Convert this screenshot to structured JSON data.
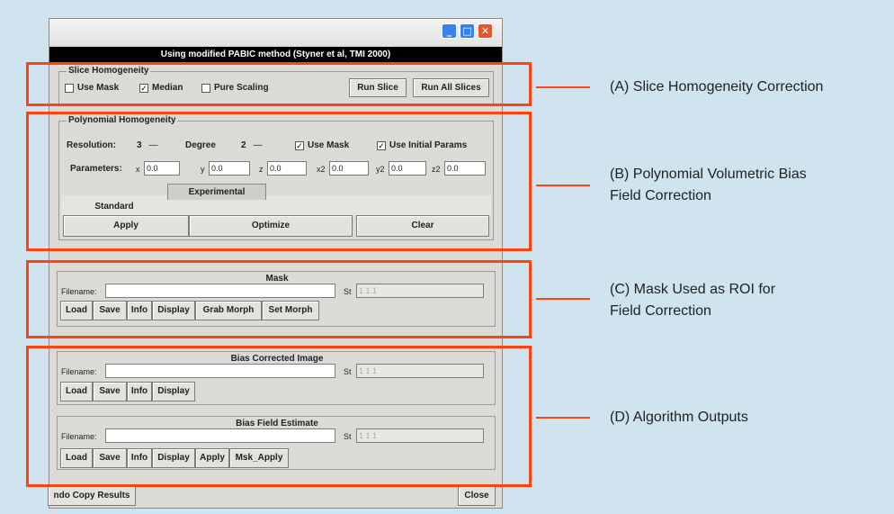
{
  "window": {
    "header": "Using modified PABIC method (Styner et al, TMI 2000)",
    "min_glyph": "_",
    "max_glyph": "□",
    "close_glyph": "✕"
  },
  "slice": {
    "title": "Slice Homogeneity",
    "use_mask": "Use Mask",
    "median": "Median",
    "pure_scaling": "Pure Scaling",
    "run_slice": "Run Slice",
    "run_all": "Run All Slices"
  },
  "poly": {
    "title": "Polynomial Homogeneity",
    "resolution_label": "Resolution:",
    "resolution_value": "3",
    "degree_label": "Degree",
    "degree_value": "2",
    "use_mask": "Use Mask",
    "use_initial": "Use Initial Params",
    "parameters_label": "Parameters:",
    "x_label": "x",
    "x_value": "0.0",
    "y_label": "y",
    "y_value": "0.0",
    "z_label": "z",
    "z_value": "0.0",
    "x2_label": "x2",
    "x2_value": "0.0",
    "y2_label": "y2",
    "y2_value": "0.0",
    "z2_label": "z2",
    "z2_value": "0.0",
    "tab_standard": "Standard",
    "tab_experimental": "Experimental",
    "apply": "Apply",
    "optimize": "Optimize",
    "clear": "Clear"
  },
  "mask": {
    "title": "Mask",
    "filename_label": "Filename:",
    "filename_value": "",
    "st_label": "St",
    "st_value": "1 1 1",
    "load": "Load",
    "save": "Save",
    "info": "Info",
    "display": "Display",
    "grab_morph": "Grab Morph",
    "set_morph": "Set Morph"
  },
  "bias_image": {
    "title": "Bias Corrected Image",
    "filename_label": "Filename:",
    "filename_value": "",
    "st_label": "St",
    "st_value": "1 1 1",
    "load": "Load",
    "save": "Save",
    "info": "Info",
    "display": "Display"
  },
  "bias_field": {
    "title": "Bias Field Estimate",
    "filename_label": "Filename:",
    "filename_value": "",
    "st_label": "St",
    "st_value": "1 1 1",
    "load": "Load",
    "save": "Save",
    "info": "Info",
    "display": "Display",
    "apply": "Apply",
    "msk_apply": "Msk_Apply"
  },
  "footer": {
    "undo": "ndo Copy Results",
    "close": "Close"
  },
  "annotations": {
    "a": "(A) Slice Homogeneity Correction",
    "b1": "(B) Polynomial Volumetric Bias",
    "b2": "Field Correction",
    "c1": "(C) Mask Used as ROI for",
    "c2": "Field Correction",
    "d": "(D) Algorithm Outputs"
  },
  "colors": {
    "highlight": "#ff4411",
    "background": "#cfe4ee",
    "panel": "#dcdad5"
  }
}
